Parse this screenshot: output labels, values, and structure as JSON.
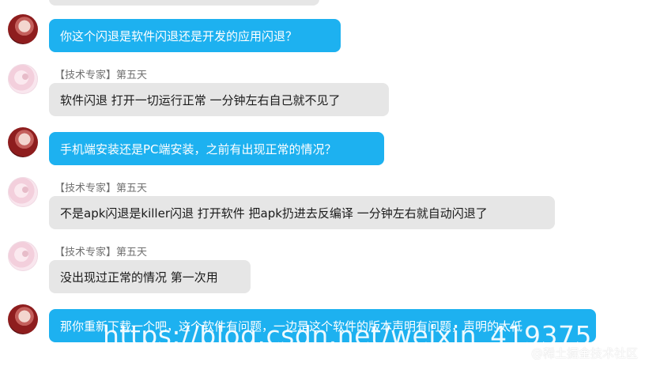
{
  "chat": {
    "messages": [
      {
        "side": "me",
        "sender": "",
        "text": "你这个闪退是软件闪退还是开发的应用闪退？"
      },
      {
        "side": "them",
        "sender": "【技术专家】第五天",
        "text": "软件闪退 打开一切运行正常 一分钟左右自己就不见了"
      },
      {
        "side": "me",
        "sender": "",
        "text": "手机端安装还是PC端安装，之前有出现正常的情况？"
      },
      {
        "side": "them",
        "sender": "【技术专家】第五天",
        "text": "不是apk闪退是killer闪退 打开软件 把apk扔进去反编译 一分钟左右就自动闪退了"
      },
      {
        "side": "them",
        "sender": "【技术专家】第五天",
        "text": "没出现过正常的情况 第一次用"
      },
      {
        "side": "me",
        "sender": "",
        "text": "那你重新下载一个吧，这个软件有问题，一边是这个软件的版本声明有问题，声明的太低"
      }
    ]
  },
  "watermark": {
    "url_text": "https://blog.csdn.net/weixin_419375",
    "site_text": "@稀土掘金技术社区"
  },
  "colors": {
    "me_bubble": "#1db1f0",
    "them_bubble": "#e6e6e6",
    "sender_name": "#707070"
  }
}
